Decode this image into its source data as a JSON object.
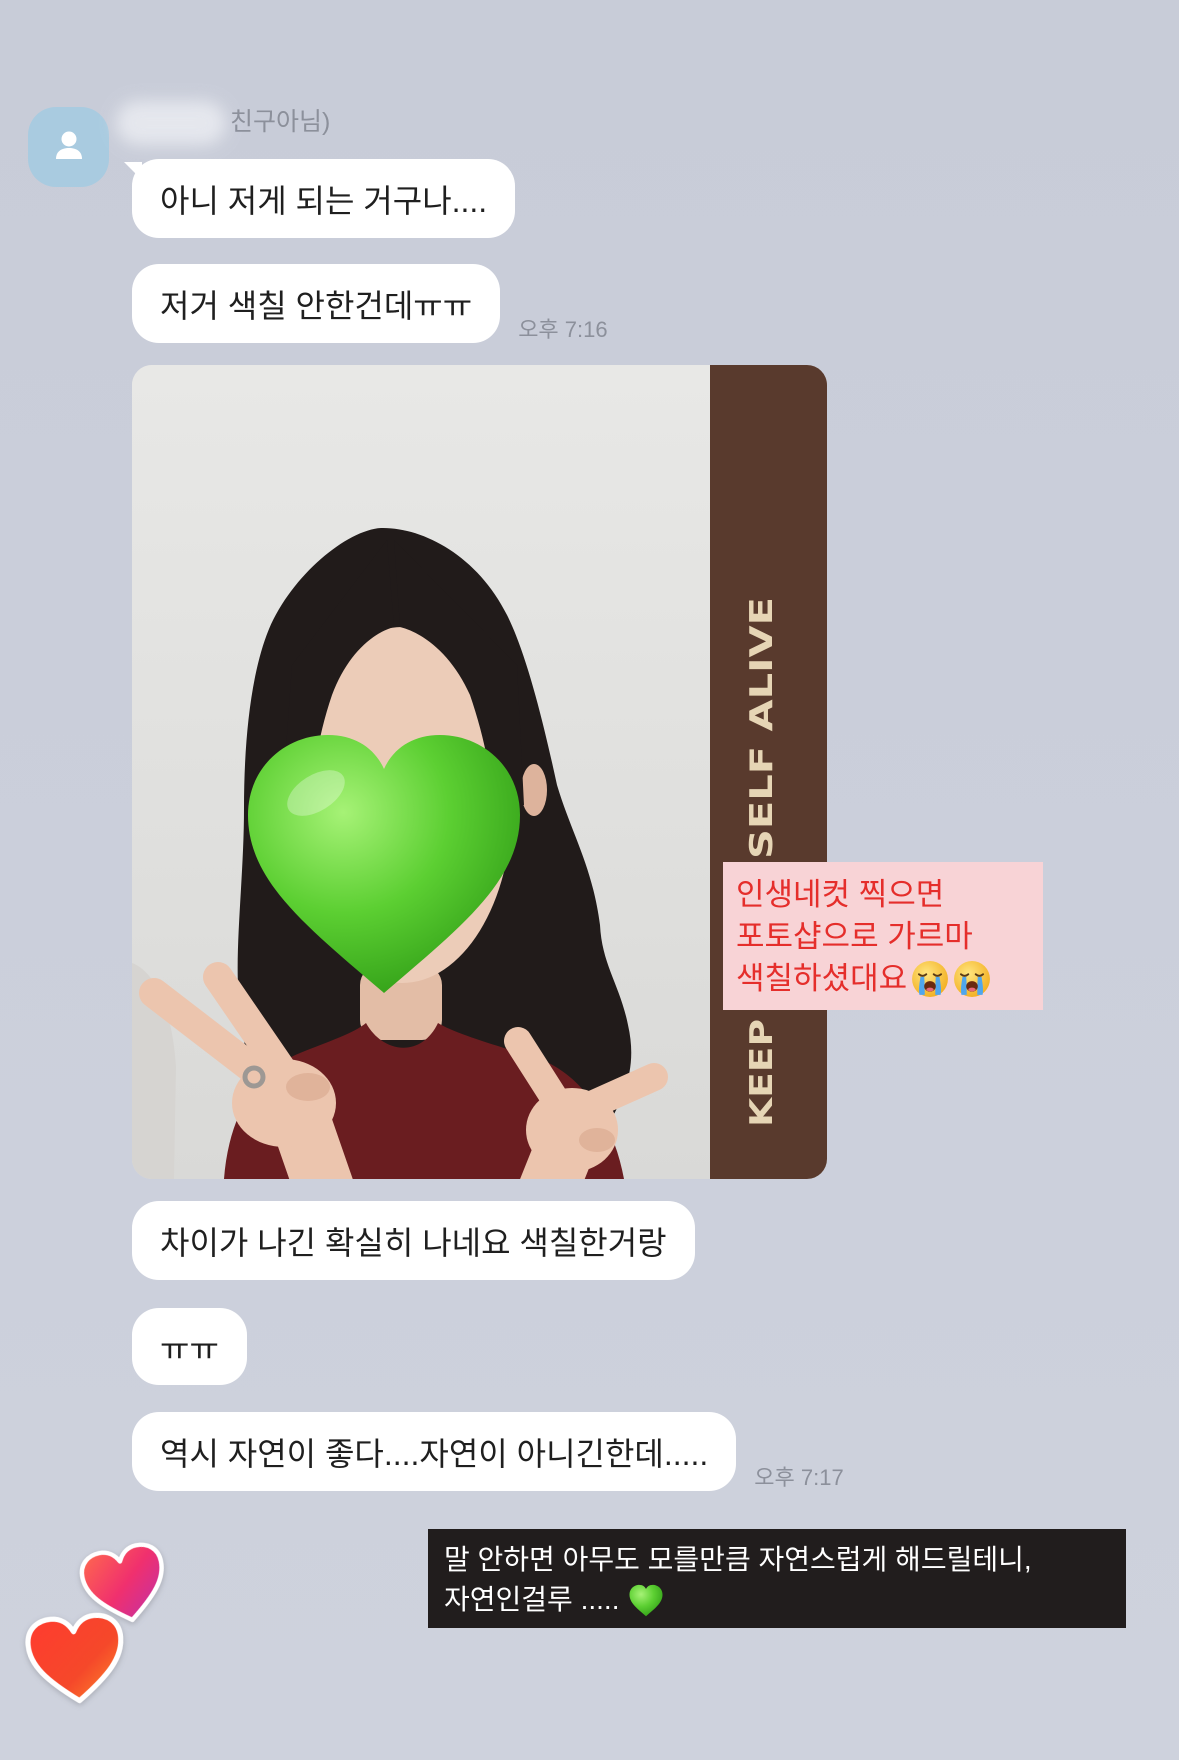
{
  "theme": {
    "background": "#cbcfdb",
    "bubble": "#ffffff",
    "bubble_text": "#1f1f1f",
    "meta_text": "#8c909b",
    "avatar": "#a9cbe0",
    "annotation_background": "#f8d3d6",
    "annotation_text": "#e52e2b",
    "caption_background": "#211d1d",
    "caption_text": "#ffffff",
    "photo_strip": "#593a2d",
    "photo_strip_text": "#e6d5b5"
  },
  "sender": {
    "avatar_icon": "person-icon",
    "name": "친구아님)"
  },
  "messages": [
    {
      "text": "아니 저게 되는 거구나...."
    },
    {
      "text": "저거 색칠 안한건데ㅠㅠ",
      "time": "오후 7:16"
    },
    {
      "photo": {
        "face_cover_icon": "green-heart-icon",
        "frame_text": [
          "KEEP",
          "SELF ALIVE"
        ]
      }
    },
    {
      "text": "차이가 나긴 확실히 나네요 색칠한거랑"
    },
    {
      "text": "ㅠㅠ"
    },
    {
      "text": "역시 자연이 좋다....자연이 아니긴한데.....",
      "time": "오후 7:17"
    }
  ],
  "story_overlays": {
    "annotation": {
      "lines": [
        "인생네컷 찍으면",
        "포토샵으로 가르마",
        "색칠하셨대요"
      ],
      "trailing_icons": [
        "loudly-crying-face-icon",
        "loudly-crying-face-icon"
      ]
    },
    "caption": {
      "lines": [
        "말 안하면 아무도 모를만큼 자연스럽게 해드릴테니,",
        "자연인걸루 ....."
      ],
      "trailing_icon": "green-heart-icon"
    },
    "stickers": [
      "heart-sticker-icon",
      "heart-sticker-icon"
    ]
  }
}
